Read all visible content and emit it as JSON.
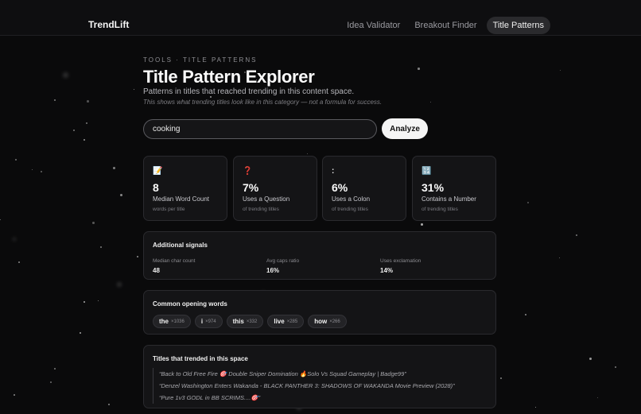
{
  "app": {
    "brand": "TrendLift"
  },
  "nav": [
    {
      "label": "Idea Validator",
      "active": false
    },
    {
      "label": "Breakout Finder",
      "active": false
    },
    {
      "label": "Title Patterns",
      "active": true
    }
  ],
  "header": {
    "breadcrumb": "TOOLS · TITLE PATTERNS",
    "title": "Title Pattern Explorer",
    "description": "Patterns in titles that reached trending in this content space.",
    "note": "This shows what trending titles look like in this category — not a formula for success."
  },
  "search": {
    "value": "cooking",
    "button_label": "Analyze"
  },
  "stats": [
    {
      "icon": "memo-icon",
      "glyph": "📝",
      "value": "8",
      "label": "Median Word Count",
      "sub": "words per title"
    },
    {
      "icon": "question-icon",
      "glyph": "❓",
      "value": "7%",
      "label": "Uses a Question",
      "sub": "of trending titles"
    },
    {
      "icon": "colon-icon",
      "glyph": ":",
      "value": "6%",
      "label": "Uses a Colon",
      "sub": "of trending titles"
    },
    {
      "icon": "numbers-icon",
      "glyph": "🔢",
      "value": "31%",
      "label": "Contains a Number",
      "sub": "of trending titles"
    }
  ],
  "signals": {
    "title": "Additional signals",
    "items": [
      {
        "label": "Median char count",
        "value": "48"
      },
      {
        "label": "Avg caps ratio",
        "value": "16%"
      },
      {
        "label": "Uses exclamation",
        "value": "14%"
      }
    ]
  },
  "opening_words": {
    "title": "Common opening words",
    "items": [
      {
        "word": "the",
        "count": "×1036"
      },
      {
        "word": "i",
        "count": "×974"
      },
      {
        "word": "this",
        "count": "×332"
      },
      {
        "word": "live",
        "count": "×285"
      },
      {
        "word": "how",
        "count": "×266"
      }
    ]
  },
  "trending_titles": {
    "title": "Titles that trended in this space",
    "items": [
      "“Back to Old Free Fire 🎯 Double Sniper Domination 🔥Solo Vs Squad Gameplay | Badge99”",
      "“Denzel Washington Enters Wakanda - BLACK PANTHER 3: SHADOWS OF WAKANDA Movie Preview (2028)”",
      "“Pure 1v3 GODL in BB SCRIMS....🎯”"
    ]
  }
}
